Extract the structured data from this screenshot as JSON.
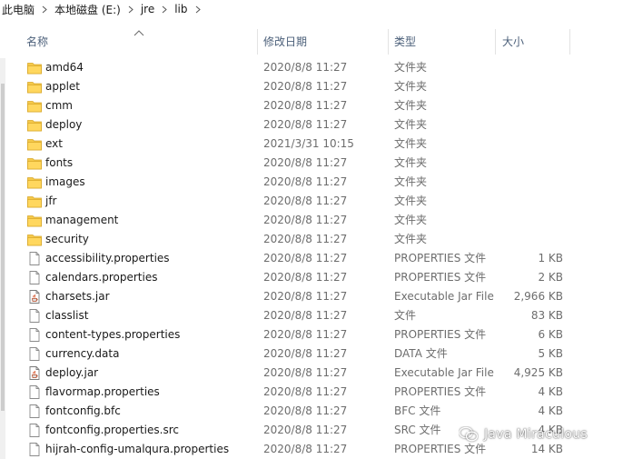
{
  "breadcrumb": [
    "此电脑",
    "本地磁盘 (E:)",
    "jre",
    "lib"
  ],
  "columns": {
    "name": "名称",
    "modified": "修改日期",
    "type": "类型",
    "size": "大小"
  },
  "sort": {
    "column": "name",
    "direction": "ascending"
  },
  "colors": {
    "folder": "#f5c94a",
    "header_text": "#4c607a",
    "meta_text": "#6d6d6d"
  },
  "files": [
    {
      "name": "amd64",
      "modified": "2020/8/8 11:27",
      "type": "文件夹",
      "size": "",
      "icon": "folder-icon"
    },
    {
      "name": "applet",
      "modified": "2020/8/8 11:27",
      "type": "文件夹",
      "size": "",
      "icon": "folder-icon"
    },
    {
      "name": "cmm",
      "modified": "2020/8/8 11:27",
      "type": "文件夹",
      "size": "",
      "icon": "folder-icon"
    },
    {
      "name": "deploy",
      "modified": "2020/8/8 11:27",
      "type": "文件夹",
      "size": "",
      "icon": "folder-icon"
    },
    {
      "name": "ext",
      "modified": "2021/3/31 10:15",
      "type": "文件夹",
      "size": "",
      "icon": "folder-icon"
    },
    {
      "name": "fonts",
      "modified": "2020/8/8 11:27",
      "type": "文件夹",
      "size": "",
      "icon": "folder-icon"
    },
    {
      "name": "images",
      "modified": "2020/8/8 11:27",
      "type": "文件夹",
      "size": "",
      "icon": "folder-icon"
    },
    {
      "name": "jfr",
      "modified": "2020/8/8 11:27",
      "type": "文件夹",
      "size": "",
      "icon": "folder-icon"
    },
    {
      "name": "management",
      "modified": "2020/8/8 11:27",
      "type": "文件夹",
      "size": "",
      "icon": "folder-icon"
    },
    {
      "name": "security",
      "modified": "2020/8/8 11:27",
      "type": "文件夹",
      "size": "",
      "icon": "folder-icon"
    },
    {
      "name": "accessibility.properties",
      "modified": "2020/8/8 11:27",
      "type": "PROPERTIES 文件",
      "size": "1 KB",
      "icon": "document-icon"
    },
    {
      "name": "calendars.properties",
      "modified": "2020/8/8 11:27",
      "type": "PROPERTIES 文件",
      "size": "2 KB",
      "icon": "document-icon"
    },
    {
      "name": "charsets.jar",
      "modified": "2020/8/8 11:27",
      "type": "Executable Jar File",
      "size": "2,966 KB",
      "icon": "jar-file-icon"
    },
    {
      "name": "classlist",
      "modified": "2020/8/8 11:27",
      "type": "文件",
      "size": "83 KB",
      "icon": "document-icon"
    },
    {
      "name": "content-types.properties",
      "modified": "2020/8/8 11:27",
      "type": "PROPERTIES 文件",
      "size": "6 KB",
      "icon": "document-icon"
    },
    {
      "name": "currency.data",
      "modified": "2020/8/8 11:27",
      "type": "DATA 文件",
      "size": "5 KB",
      "icon": "document-icon"
    },
    {
      "name": "deploy.jar",
      "modified": "2020/8/8 11:27",
      "type": "Executable Jar File",
      "size": "4,925 KB",
      "icon": "jar-file-icon"
    },
    {
      "name": "flavormap.properties",
      "modified": "2020/8/8 11:27",
      "type": "PROPERTIES 文件",
      "size": "4 KB",
      "icon": "document-icon"
    },
    {
      "name": "fontconfig.bfc",
      "modified": "2020/8/8 11:27",
      "type": "BFC 文件",
      "size": "4 KB",
      "icon": "document-icon"
    },
    {
      "name": "fontconfig.properties.src",
      "modified": "2020/8/8 11:27",
      "type": "SRC 文件",
      "size": "4 KB",
      "icon": "document-icon"
    },
    {
      "name": "hijrah-config-umalqura.properties",
      "modified": "2020/8/8 11:27",
      "type": "PROPERTIES 文件",
      "size": "14 KB",
      "icon": "document-icon"
    }
  ],
  "watermark": {
    "text": "Java Miraculous",
    "icon": "wechat-icon"
  }
}
